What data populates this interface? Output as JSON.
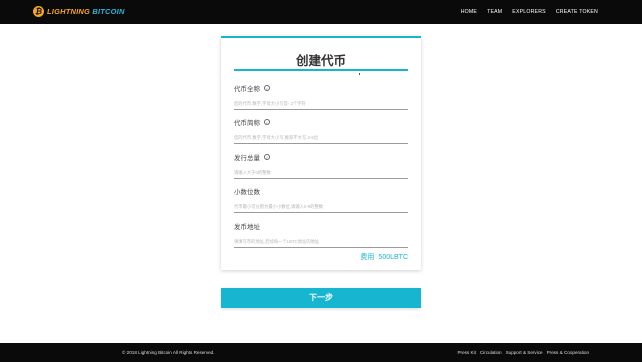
{
  "header": {
    "logo_text_main": "LIGHTNING",
    "logo_text_sub": "BITCOIN",
    "logo_badge": "₿",
    "nav": [
      "HOME",
      "TEAM",
      "EXPLORERS",
      "CREATE TOKEN"
    ]
  },
  "form": {
    "title": "创建代币",
    "fields": [
      {
        "label": "代币全称",
        "placeholder": "您的代币,数字,字母大小写及-,3个字符"
      },
      {
        "label": "代币简称",
        "placeholder": "您的代币,数字,字母大小写,推荐不大写,2-5位"
      },
      {
        "label": "发行总量",
        "placeholder": "请输入大于0的整数"
      },
      {
        "label": "小数位数",
        "placeholder": "代币最小可分割为最小小数位,请输入0-9的整数"
      },
      {
        "label": "发币地址",
        "placeholder": "请填写币的地址,后续每一个LBTC地址的地址"
      }
    ],
    "info_glyph": "i",
    "fee_label": "费用",
    "fee_value": "500LBTC",
    "next_button": "下一步"
  },
  "footer": {
    "copyright": "© 2018 Lightning Bitcoin All Rights Reserved.",
    "links": [
      "Press Kit",
      "Circulation",
      "Support & Service",
      "Press & Cooperation"
    ]
  },
  "colors": {
    "accent": "#18b5d1",
    "logo": "#f5a623",
    "bar": "#0a0a0a"
  }
}
